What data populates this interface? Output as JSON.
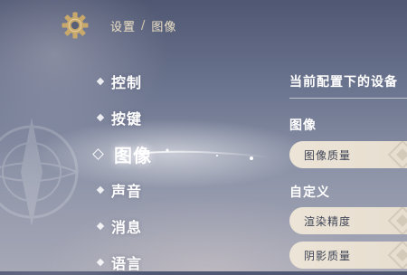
{
  "header": {
    "icon": "gear-icon",
    "breadcrumb": {
      "parent": "设置",
      "separator": "/",
      "current": "图像"
    }
  },
  "nav": {
    "items": [
      {
        "label": "控制",
        "active": false
      },
      {
        "label": "按键",
        "active": false
      },
      {
        "label": "图像",
        "active": true
      },
      {
        "label": "声音",
        "active": false
      },
      {
        "label": "消息",
        "active": false
      },
      {
        "label": "语言",
        "active": false
      }
    ]
  },
  "panel": {
    "title": "当前配置下的设备",
    "sections": [
      {
        "title": "图像",
        "options": [
          {
            "label": "图像质量"
          }
        ]
      },
      {
        "title": "自定义",
        "options": [
          {
            "label": "渲染精度"
          },
          {
            "label": "阴影质量"
          }
        ]
      }
    ]
  },
  "colors": {
    "accent_gold": "#c9a96b",
    "breadcrumb_text": "#efe2c6",
    "option_bg": "#ece4d6",
    "option_text": "#3d4456"
  }
}
